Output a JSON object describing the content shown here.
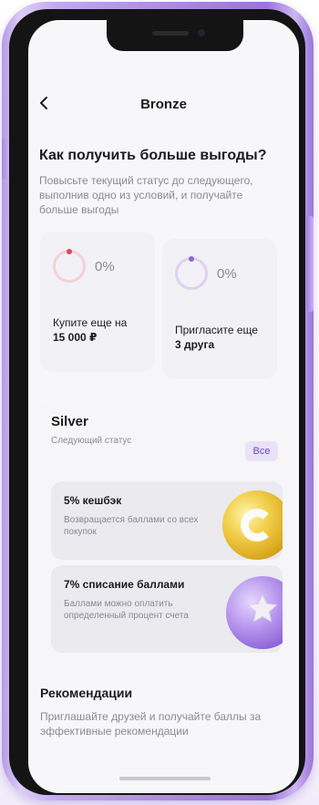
{
  "header": {
    "title": "Bronze"
  },
  "benefits_section": {
    "title": "Как получить больше выгоды?",
    "description": "Повысьте текущий статус до следующего, выполнив одно из условий, и получайте больше выгоды"
  },
  "conditions": [
    {
      "progress": "0%",
      "label": "Купите еще на",
      "value": "15 000 ₽",
      "progress_fraction": 0,
      "color": "#d74a5d"
    },
    {
      "progress": "0%",
      "label": "Пригласите еще",
      "value": "3 друга",
      "progress_fraction": 0,
      "color": "#8b67d6"
    }
  ],
  "next_status": {
    "title": "Silver",
    "subtitle": "Следующий статус",
    "all_button": "Все",
    "items": [
      {
        "title": "5% кешбэк",
        "description": "Возвращается баллами со всех покупок",
        "icon": "gold-coin-icon"
      },
      {
        "title": "7% списание баллами",
        "description": "Баллами можно оплатить определенный процент счета",
        "icon": "purple-star-coin-icon"
      }
    ]
  },
  "recommendations": {
    "title": "Рекомендации",
    "description": "Приглашайте друзей и получайте баллы за эффективные рекомендации"
  },
  "colors": {
    "frame": "#a986e2",
    "accent": "#6b49c7",
    "accent_bg": "#e9e2f8"
  }
}
